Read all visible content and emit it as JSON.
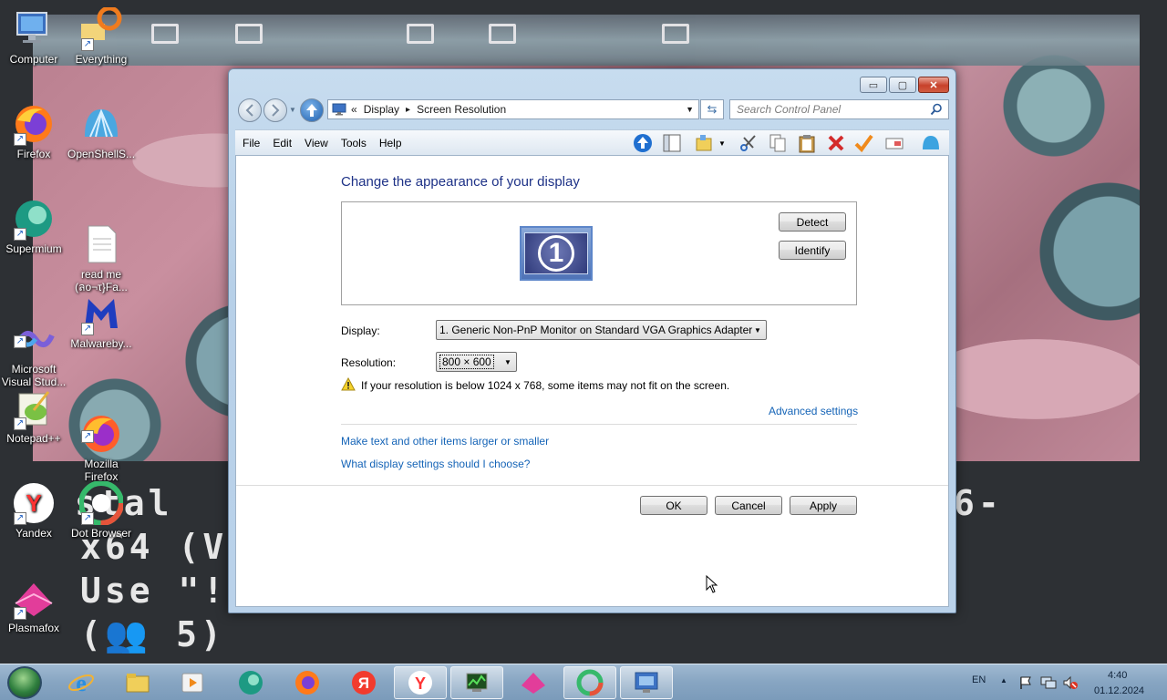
{
  "desktop_icons": [
    {
      "id": "computer",
      "label": "Computer"
    },
    {
      "id": "everything",
      "label": "Everything"
    },
    {
      "id": "firefox",
      "label": "Firefox"
    },
    {
      "id": "openshell",
      "label": "OpenShellS..."
    },
    {
      "id": "supermium",
      "label": "Supermium"
    },
    {
      "id": "readme",
      "label": "read me\n(ลo¬τ}Fa..."
    },
    {
      "id": "vstudio",
      "label": "Microsoft\nVisual Stud..."
    },
    {
      "id": "malwarebytes",
      "label": "Malwareby..."
    },
    {
      "id": "notepadpp",
      "label": "Notepad++"
    },
    {
      "id": "mozilla",
      "label": "Mozilla\nFirefox"
    },
    {
      "id": "yandex",
      "label": "Yandex"
    },
    {
      "id": "dotbrowser",
      "label": "Dot Browser"
    },
    {
      "id": "plasmafox",
      "label": "Plasmafox"
    }
  ],
  "console": {
    "line1": "stal",
    "line1_right": "6-",
    "line2": "x64 (V",
    "line3": "Use \"!I",
    "line4": "(👥 5)"
  },
  "window": {
    "caption_buttons": {
      "minimize": "▭",
      "maximize": "▢",
      "close": "✕"
    },
    "address": {
      "chevrons": "«",
      "crumb1": "Display",
      "separator": "▸",
      "crumb2": "Screen Resolution"
    },
    "search_placeholder": "Search Control Panel",
    "menu": [
      "File",
      "Edit",
      "View",
      "Tools",
      "Help"
    ],
    "title": "Change the appearance of your display",
    "monitor_number": "1",
    "detect_label": "Detect",
    "identify_label": "Identify",
    "display_label": "Display:",
    "display_value": "1. Generic Non-PnP Monitor on Standard VGA Graphics Adapter",
    "resolution_label": "Resolution:",
    "resolution_value": "800 × 600",
    "warning_text": "If your resolution is below 1024 x 768, some items may not fit on the screen.",
    "advanced_link": "Advanced settings",
    "link_text_size": "Make text and other items larger or smaller",
    "link_help": "What display settings should I choose?",
    "ok_label": "OK",
    "cancel_label": "Cancel",
    "apply_label": "Apply"
  },
  "taskbar": {
    "pinned": [
      "internet-explorer",
      "file-explorer",
      "media-player",
      "supermium",
      "firefox",
      "yandex-browser",
      "yandex",
      "task-manager",
      "plasmafox",
      "dot-browser",
      "control-panel"
    ],
    "language": "EN",
    "time": "4:40",
    "date": "01.12.2024"
  }
}
